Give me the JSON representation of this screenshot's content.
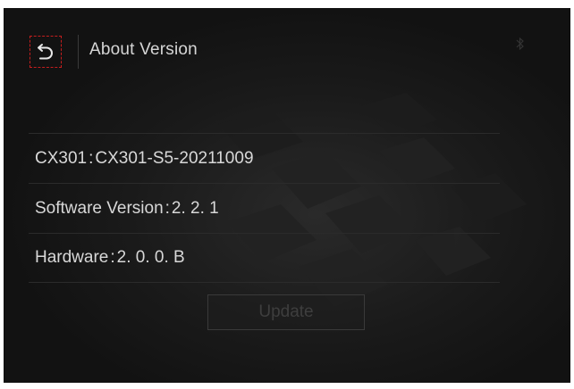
{
  "header": {
    "title": "About Version",
    "back_icon": "back-arrow-icon",
    "back_border_color": "#c41e1e"
  },
  "info": {
    "model_label": "CX301",
    "model_value": "CX301-S5-20211009",
    "software_label": "Software Version",
    "software_value": "2. 2. 1",
    "hardware_label": "Hardware",
    "hardware_value": "2. 0. 0. B",
    "separator": ":"
  },
  "actions": {
    "update_label": "Update"
  },
  "colors": {
    "background": "#151515",
    "text": "#d8d8d8",
    "divider": "#2b2b2b",
    "disabled_text": "#3e3e3e"
  }
}
